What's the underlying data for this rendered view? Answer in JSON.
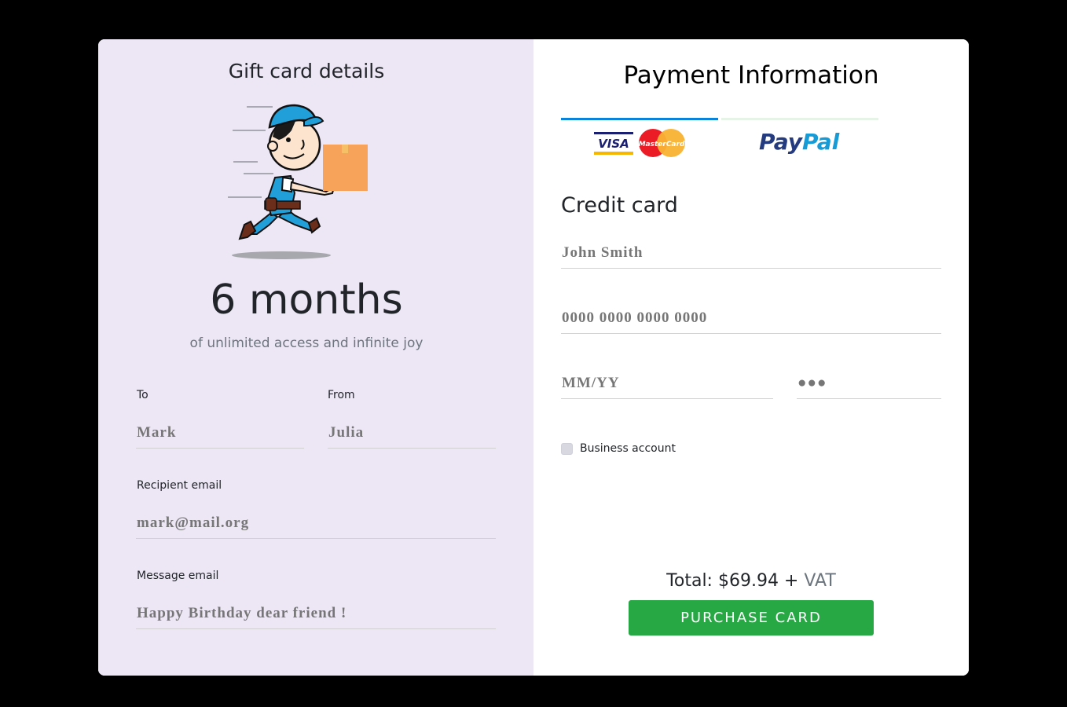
{
  "gift": {
    "title": "Gift card details",
    "illustration": "delivery-man-running-with-box",
    "duration": "6 months",
    "tagline": "of unlimited access and infinite joy",
    "to_label": "To",
    "to_value": "Mark",
    "from_label": "From",
    "from_value": "Julia",
    "recipient_email_label": "Recipient email",
    "recipient_email_value": "mark@mail.org",
    "message_label": "Message email",
    "message_value": "Happy Birthday dear friend !"
  },
  "payment": {
    "title": "Payment Information",
    "tabs": [
      {
        "label": "Visa / MasterCard",
        "icons": [
          "visa-logo",
          "mastercard-logo"
        ],
        "active": true
      },
      {
        "label": "PayPal",
        "icons": [
          "paypal-logo"
        ],
        "active": false
      }
    ],
    "visa_text": "VISA",
    "mastercard_text": "MasterCard",
    "paypal_part1": "Pay",
    "paypal_part2": "Pal",
    "section_title": "Credit card",
    "name_placeholder": "John Smith",
    "card_number_placeholder": "0000 0000 0000 0000",
    "expiry_placeholder": "MM/YY",
    "cvv_placeholder": "●●●",
    "business_label": "Business account",
    "business_checked": false,
    "total_label": "Total: $69.94 +",
    "total_vat": "VAT",
    "purchase_label": "PURCHASE CARD"
  },
  "colors": {
    "left_panel": "#ede6f5",
    "accent_blue": "#0a84d8",
    "purchase_green": "#28a745"
  }
}
